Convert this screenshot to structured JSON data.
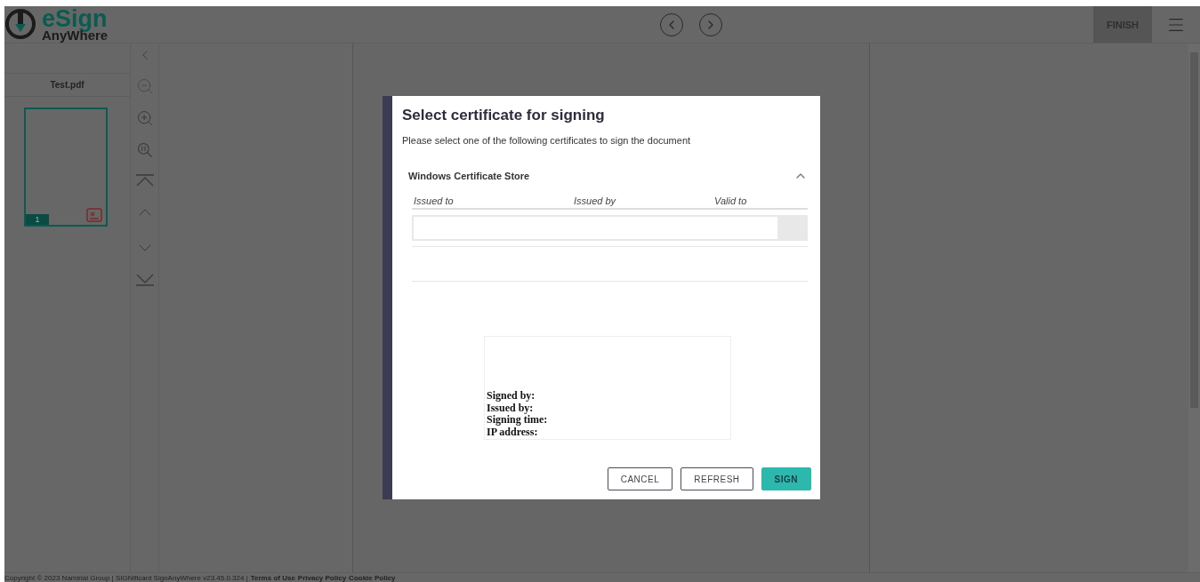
{
  "header": {
    "logo": {
      "line_1": "eSign",
      "line_2": "AnyWhere"
    },
    "finish_button": "FINISH"
  },
  "sidebar": {
    "document": "Test.pdf",
    "thumbnails": [
      {
        "page": "1",
        "selected": true
      }
    ]
  },
  "dialog": {
    "title": "Select certificate for signing",
    "description": "Please select one of the following certificates to sign the document",
    "section": {
      "title": "Windows Certificate Store",
      "expanded": true,
      "columns": [
        "Issued to",
        "Issued by",
        "Valid to"
      ]
    },
    "signature_preview": [
      "Signed by:",
      "Issued by:",
      "Signing time:",
      "IP address:"
    ],
    "buttons": [
      {
        "label": "CANCEL",
        "kind": "outline"
      },
      {
        "label": "REFRESH",
        "kind": "outline"
      },
      {
        "label": "SIGN",
        "kind": "primary"
      }
    ]
  },
  "footer": {
    "copyright": "Copyright © 2023 Namirial Group | SIGNificant SignAnyWhere v23.45.0.324 |",
    "links": [
      "Terms of Use",
      "Privacy Policy",
      "Cookie Policy"
    ]
  }
}
